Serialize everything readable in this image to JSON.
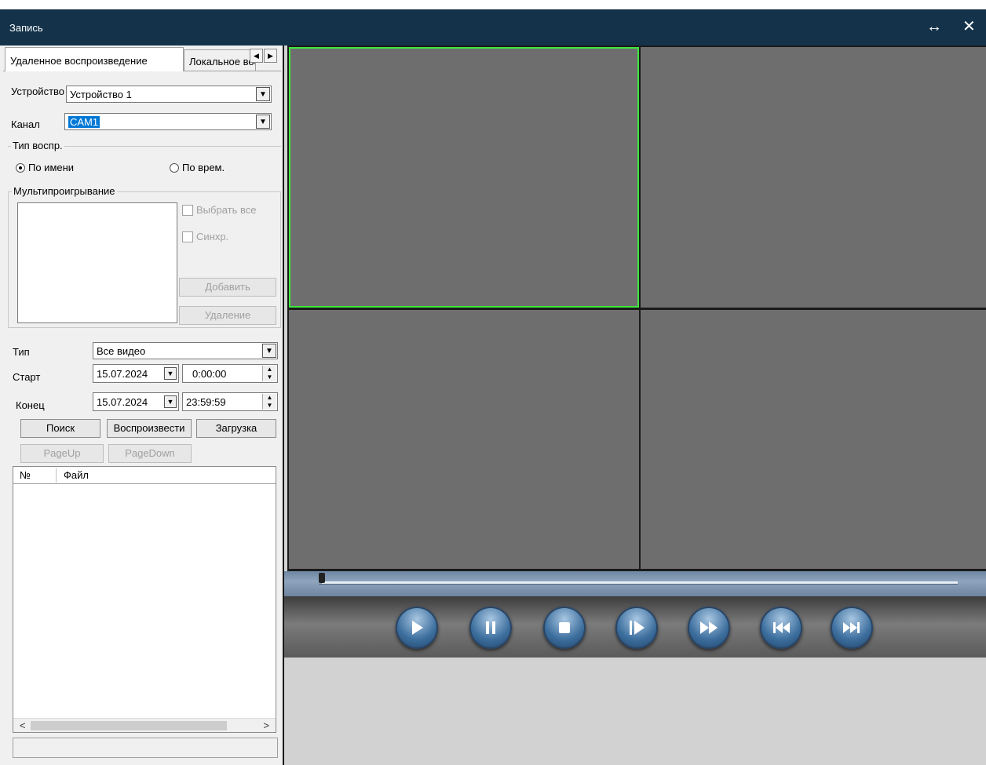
{
  "window": {
    "title": "Запись",
    "maximize_glyph": "↔",
    "close_glyph": "✕"
  },
  "tabs": [
    {
      "label": "Удаленное воспроизведение"
    },
    {
      "label": "Локальное воспроизведение"
    }
  ],
  "device": {
    "label": "Устройство",
    "value": "Устройство 1"
  },
  "channel": {
    "label": "Канал",
    "value": "CAM1"
  },
  "playback_type": {
    "legend": "Тип воспр.",
    "by_name": "По имени",
    "by_time": "По врем.",
    "selected": "by_name"
  },
  "multiplay": {
    "legend": "Мультипроигрывание",
    "select_all": "Выбрать все",
    "sync": "Синхр.",
    "add": "Добавить",
    "delete": "Удаление"
  },
  "type": {
    "label": "Тип",
    "value": "Все видео"
  },
  "start": {
    "label": "Старт",
    "date": "15.07.2024",
    "time": "0:00:00"
  },
  "end": {
    "label": "Конец",
    "date": "15.07.2024",
    "time": "23:59:59"
  },
  "actions": {
    "search": "Поиск",
    "play": "Воспроизвести",
    "download": "Загрузка",
    "page_up": "PageUp",
    "page_down": "PageDown"
  },
  "filelist": {
    "columns": [
      "№",
      "Файл"
    ],
    "rows": []
  },
  "player": {
    "active_cell": 0,
    "seek_position": 0.0,
    "buttons": [
      "play-icon",
      "pause-icon",
      "stop-icon",
      "step-frame-icon",
      "fast-forward-icon",
      "skip-back-icon",
      "skip-forward-icon"
    ]
  },
  "colors": {
    "titlebar": "#14334a",
    "cell": "#6e6e6e",
    "active_outline": "#3ee83e",
    "selection": "#0078d7"
  }
}
